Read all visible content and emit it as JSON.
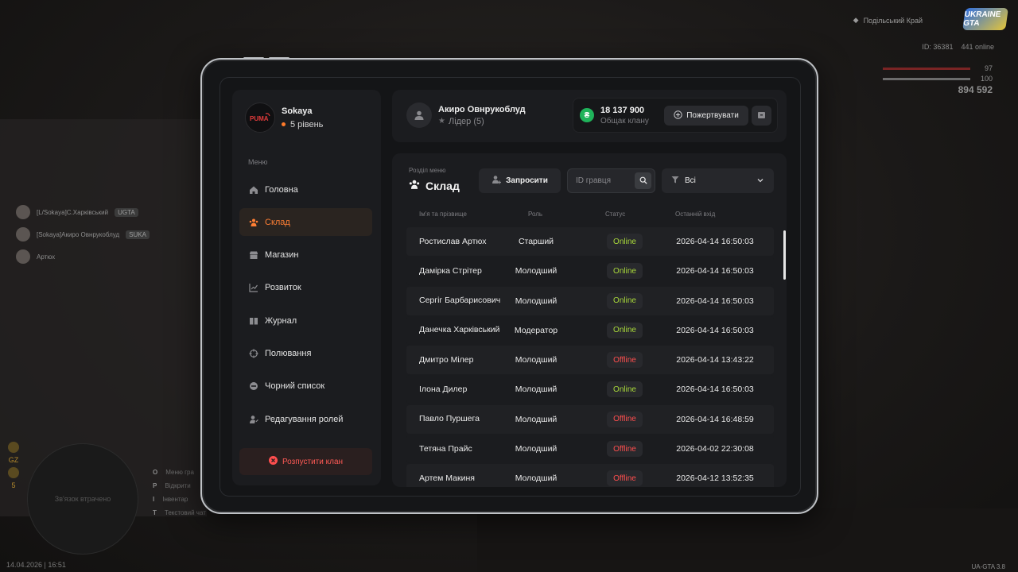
{
  "hud": {
    "server": "Подільський Край",
    "logo": "UKRAINE GTA",
    "id_text": "ID: 36381",
    "online_text": "441 online",
    "health": "97",
    "armor": "100",
    "money": "894 592",
    "date_time": "14.04.2026 | 16:51",
    "version": "UA-GTA 3.8",
    "radar_text": "Зв'язок втрачено",
    "left_badge": "GZ",
    "left_count": "5",
    "keys": [
      {
        "key": "O",
        "label": "Меню гра"
      },
      {
        "key": "P",
        "label": "Відкрити"
      },
      {
        "key": "I",
        "label": "Інвентар"
      },
      {
        "key": "T",
        "label": "Текстовий чат"
      }
    ]
  },
  "chat": [
    {
      "name": "[L/Sokaya]С.Харківський",
      "tag": "UGTA"
    },
    {
      "name": "[Sokaya]Акиро Овнрукоблуд",
      "tag": "SUKA"
    },
    {
      "name": "Артюх",
      "tag": ""
    }
  ],
  "sidebar": {
    "profile_name": "Sokaya",
    "profile_level": "5 рівень",
    "menu_label": "Меню",
    "items": [
      {
        "label": "Головна",
        "icon": "home-icon",
        "active": false
      },
      {
        "label": "Склад",
        "icon": "users-icon",
        "active": true
      },
      {
        "label": "Магазин",
        "icon": "shop-icon",
        "active": false
      },
      {
        "label": "Розвиток",
        "icon": "chart-icon",
        "active": false
      },
      {
        "label": "Журнал",
        "icon": "book-icon",
        "active": false
      },
      {
        "label": "Полювання",
        "icon": "crosshair-icon",
        "active": false
      },
      {
        "label": "Чорний список",
        "icon": "block-icon",
        "active": false
      },
      {
        "label": "Редагування ролей",
        "icon": "user-edit-icon",
        "active": false
      }
    ],
    "dissolve_label": "Розпустити клан"
  },
  "header": {
    "leader_name": "Акиро Овнрукоблуд",
    "leader_role": "Лідер (5)",
    "bank_amount": "18 137 900",
    "bank_label": "Общак клану",
    "donate_label": "Пожертвувати"
  },
  "main": {
    "section_label": "Розділ меню",
    "section_title": "Склад",
    "invite_label": "Запросити",
    "search_placeholder": "ID гравця",
    "filter_value": "Всі",
    "columns": [
      "Ім'я та прізвище",
      "Роль",
      "Статус",
      "Останній вхід"
    ],
    "rows": [
      {
        "name": "Ростислав Артюх",
        "role": "Старший",
        "status": "Online",
        "last": "2026-04-14 16:50:03"
      },
      {
        "name": "Дамірка Стрітер",
        "role": "Молодший",
        "status": "Online",
        "last": "2026-04-14 16:50:03"
      },
      {
        "name": "Сергіг Барбарисович",
        "role": "Молодший",
        "status": "Online",
        "last": "2026-04-14 16:50:03"
      },
      {
        "name": "Данечка Харківський",
        "role": "Модератор",
        "status": "Online",
        "last": "2026-04-14 16:50:03"
      },
      {
        "name": "Дмитро Мілер",
        "role": "Молодший",
        "status": "Offline",
        "last": "2026-04-14 13:43:22"
      },
      {
        "name": "Ілона Дилер",
        "role": "Молодший",
        "status": "Online",
        "last": "2026-04-14 16:50:03"
      },
      {
        "name": "Павло Пуршега",
        "role": "Молодший",
        "status": "Offline",
        "last": "2026-04-14 16:48:59"
      },
      {
        "name": "Тетяна Прайс",
        "role": "Молодший",
        "status": "Offline",
        "last": "2026-04-02 22:30:08"
      },
      {
        "name": "Артем Макиня",
        "role": "Молодший",
        "status": "Offline",
        "last": "2026-04-12 13:52:35"
      }
    ]
  },
  "colors": {
    "accent": "#ff7f34",
    "online": "#a8d83a",
    "offline": "#ff4e4e",
    "bank": "#1fb35a",
    "danger": "#ff5a55"
  }
}
